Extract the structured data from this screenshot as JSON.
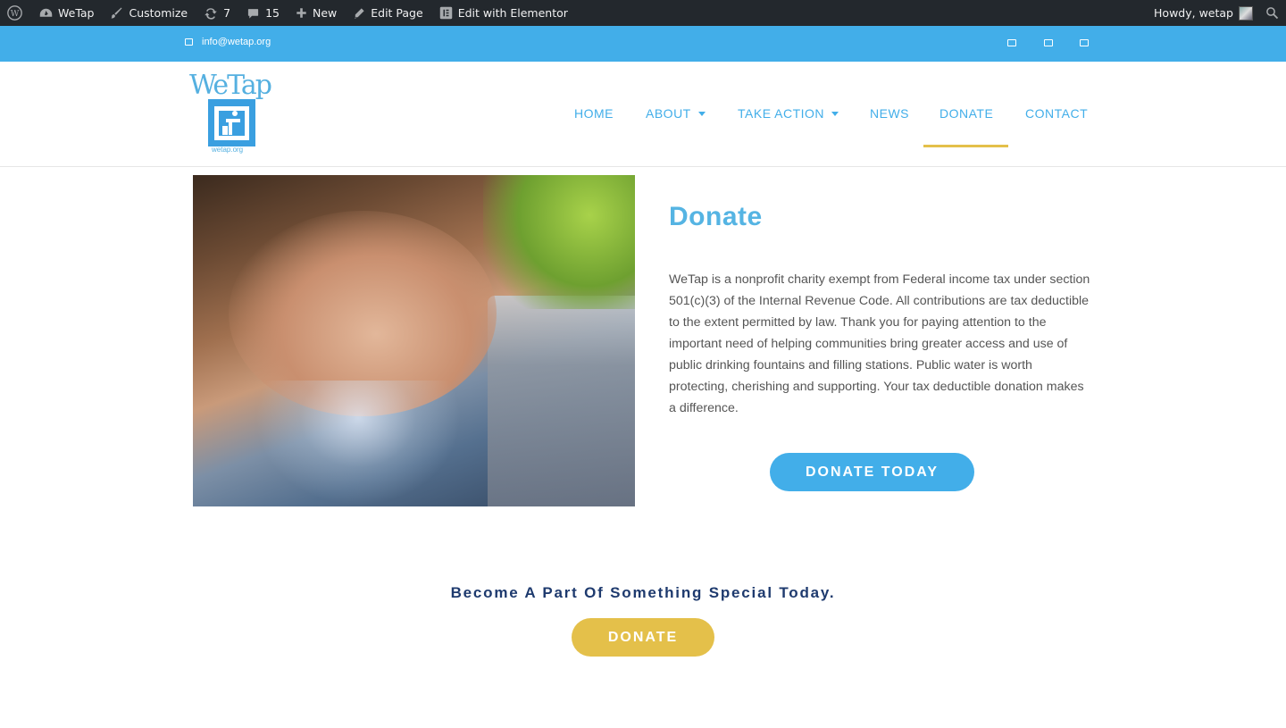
{
  "admin_bar": {
    "site_name": "WeTap",
    "customize": "Customize",
    "updates_count": "7",
    "comments_count": "15",
    "new": "New",
    "edit_page": "Edit Page",
    "edit_elementor": "Edit with Elementor",
    "howdy": "Howdy, wetap"
  },
  "top_bar": {
    "email": "info@wetap.org",
    "social_icons": [
      "square-icon",
      "square-icon",
      "square-icon"
    ]
  },
  "header": {
    "logo_text": "WeTap",
    "logo_url": "wetap.org",
    "nav": [
      {
        "label": "HOME",
        "has_dropdown": false
      },
      {
        "label": "ABOUT",
        "has_dropdown": true
      },
      {
        "label": "TAKE ACTION",
        "has_dropdown": true
      },
      {
        "label": "NEWS",
        "has_dropdown": false
      },
      {
        "label": "DONATE",
        "has_dropdown": false,
        "active": true
      },
      {
        "label": "CONTACT",
        "has_dropdown": false
      }
    ]
  },
  "main": {
    "title": "Donate",
    "paragraph": "WeTap is a nonprofit charity exempt from Federal income tax under section 501(c)(3) of the Internal Revenue Code. All contributions are tax deductible to the extent permitted by law. Thank you for paying attention to the important need of helping communities bring greater access and use of public drinking fountains and filling stations. Public water is worth protecting, cherishing and supporting. Your tax deductible donation makes a difference.",
    "donate_today_button": "DONATE TODAY"
  },
  "cta": {
    "heading": "Become A Part Of Something Special Today.",
    "button": "DONATE"
  },
  "colors": {
    "accent_blue": "#42aee9",
    "accent_gold": "#e4c04a",
    "heading_navy": "#1e3a6e",
    "admin_bar": "#23282d"
  }
}
